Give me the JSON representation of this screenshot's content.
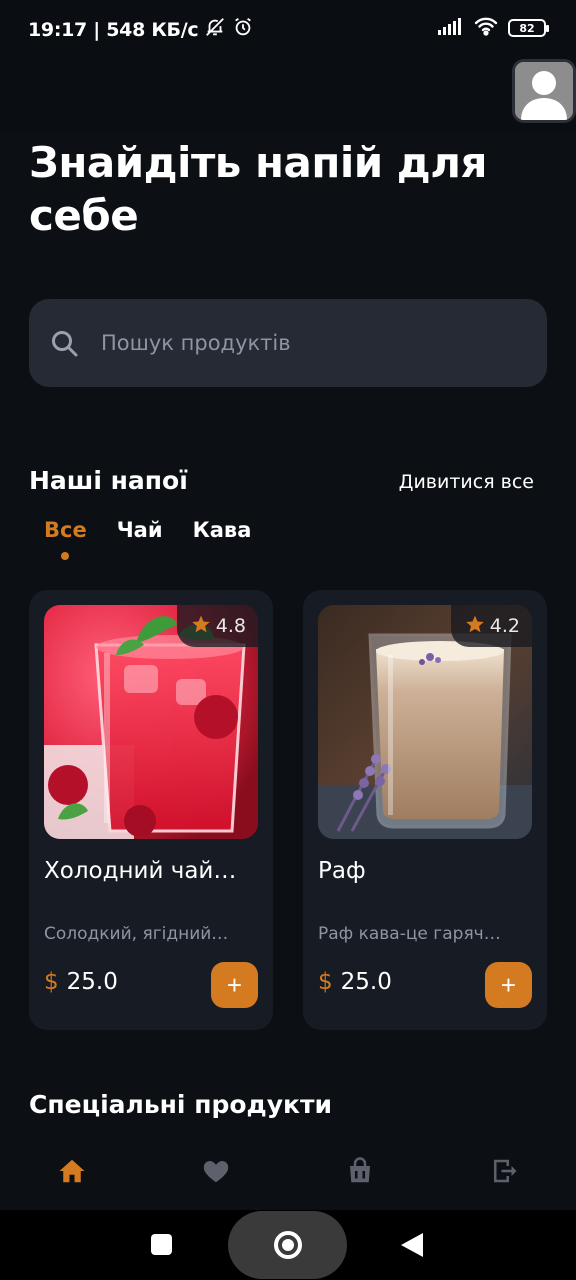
{
  "status_bar": {
    "time_speed": "19:17 | 548 КБ/с",
    "battery": "82"
  },
  "header": {
    "title": "Знайдіть напій для себе",
    "avatar_icon": "user-avatar-icon"
  },
  "search": {
    "placeholder": "Пошук продуктів",
    "value": "",
    "icon": "search-icon"
  },
  "drinks_section": {
    "title": "Наші напої",
    "see_all": "Дивитися все",
    "tabs": [
      {
        "label": "Все",
        "active": true
      },
      {
        "label": "Чай",
        "active": false
      },
      {
        "label": "Кава",
        "active": false
      }
    ],
    "products": [
      {
        "name": "Холодний чай…",
        "description": "Солодкий, ягідний…",
        "currency": "$",
        "price": "25.0",
        "rating": "4.8",
        "add_label": "+"
      },
      {
        "name": "Раф",
        "description": "Раф кава-це гаряч…",
        "currency": "$",
        "price": "25.0",
        "rating": "4.2",
        "add_label": "+"
      }
    ]
  },
  "special_section": {
    "title": "Спеціальні продукти"
  },
  "bottom_nav": [
    {
      "icon": "home-icon",
      "active": true
    },
    {
      "icon": "heart-icon",
      "active": false
    },
    {
      "icon": "shopping-bag-icon",
      "active": false
    },
    {
      "icon": "logout-icon",
      "active": false
    }
  ],
  "colors": {
    "accent": "#d47a20",
    "background": "#0c0f14",
    "card": "#171b23",
    "search": "#252a35",
    "muted_text": "#8f94a0",
    "inactive_icon": "#5c616b"
  }
}
